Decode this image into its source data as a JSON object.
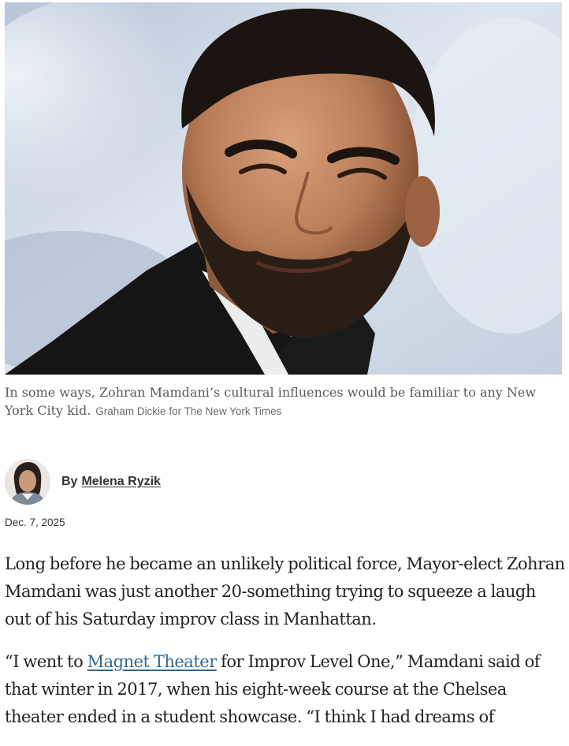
{
  "hero_image": {
    "icon": "portrait-photo"
  },
  "caption": {
    "text": "In some ways, Zohran Mamdani’s cultural influences would be familiar to any New York City kid.",
    "credit": "Graham Dickie for The New York Times"
  },
  "byline": {
    "prefix": "By",
    "author": "Melena Ryzik",
    "avatar_icon": "author-avatar"
  },
  "date": "Dec. 7, 2025",
  "article": {
    "paragraph_1": "Long before he became an unlikely political force, Mayor-elect Zohran Mamdani was just another 20-something trying to squeeze a laugh out of his Saturday improv class in Manhattan.",
    "paragraph_2_before_link": "“I went to ",
    "paragraph_2_link": "Magnet Theater",
    "paragraph_2_after_link": " for Improv Level One,” Mamdani said of that winter in 2017, when his eight-week course at the Chelsea theater ended in a student showcase. “I think I had dreams of"
  },
  "colors": {
    "link": "#326891",
    "caption_text": "#5a5a5a",
    "body_text": "#222222"
  }
}
